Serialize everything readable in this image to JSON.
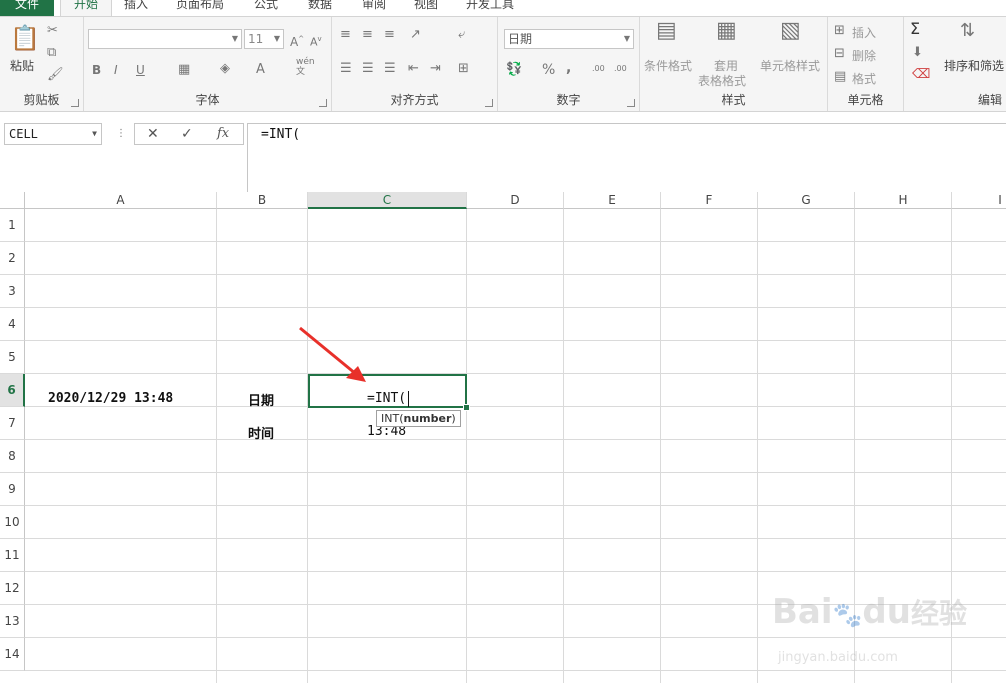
{
  "tabs": {
    "file": "文件",
    "home": "开始",
    "insert": "插入",
    "page_layout": "页面布局",
    "formulas": "公式",
    "data": "数据",
    "review": "审阅",
    "view": "视图",
    "developer": "开发工具"
  },
  "ribbon": {
    "clipboard": {
      "label": "剪贴板",
      "paste": "粘贴"
    },
    "font": {
      "label": "字体",
      "size": "11",
      "bold": "B",
      "italic": "I",
      "underline": "U",
      "font_color": "A",
      "wen": "wén",
      "wen2": "文"
    },
    "alignment": {
      "label": "对齐方式"
    },
    "number": {
      "label": "数字",
      "format": "日期",
      "percent": "%",
      "comma": ",",
      "inc_dec": ".00",
      "dec_dec": ".00"
    },
    "styles": {
      "label": "样式",
      "conditional": "条件格式",
      "table_format_1": "套用",
      "table_format_2": "表格格式",
      "cell_styles": "单元格样式"
    },
    "cells": {
      "label": "单元格",
      "insert": "插入",
      "delete": "删除",
      "format": "格式"
    },
    "editing": {
      "label": "编辑",
      "sort_filter": "排序和筛选",
      "sigma": "Σ"
    }
  },
  "formula_bar": {
    "name_box": "CELL",
    "cancel": "✕",
    "enter": "✓",
    "fx": "fx",
    "content": "=INT("
  },
  "sheet": {
    "columns": [
      "A",
      "B",
      "C",
      "D",
      "E",
      "F",
      "G",
      "H",
      "I"
    ],
    "rows": [
      "1",
      "2",
      "3",
      "4",
      "5",
      "6",
      "7",
      "8",
      "9",
      "10",
      "11",
      "12",
      "13",
      "14"
    ],
    "a6": "2020/12/29 13:48",
    "b6": "日期",
    "b7": "时间",
    "c6": "=INT(",
    "c7": "13:48",
    "tooltip_fn": "INT(",
    "tooltip_arg": "number",
    "tooltip_close": ")"
  },
  "watermark": {
    "brand": "Bai",
    "brand2": "du",
    "cn": "经验",
    "url": "jingyan.baidu.com"
  },
  "colors": {
    "accent": "#217346",
    "arrow": "#e8302a"
  }
}
